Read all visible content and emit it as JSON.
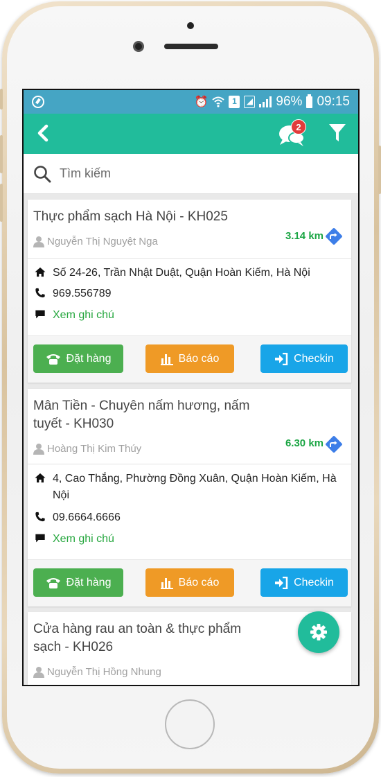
{
  "status_bar": {
    "battery_percent": "96%",
    "time": "09:15",
    "sim_slot": "1"
  },
  "app_bar": {
    "back_icon": "chevron-left-icon",
    "chat_icon": "chat-bubbles-icon",
    "chat_badge": "2",
    "filter_icon": "filter-icon"
  },
  "search": {
    "placeholder": "Tìm kiếm",
    "value": ""
  },
  "customers": [
    {
      "title": "Thực phẩm sạch Hà Nội - KH025",
      "owner": "Nguyễn Thị Nguyệt Nga",
      "distance": "3.14 km",
      "address": "Số 24-26, Trần Nhật Duật, Quận Hoàn Kiếm, Hà Nội",
      "phone": "969.556789",
      "note_link": "Xem ghi chú",
      "buttons": {
        "order": "Đặt hàng",
        "report": "Báo cáo",
        "checkin": "Checkin"
      }
    },
    {
      "title": "Mân Tiền - Chuyên nấm hương, nấm tuyết - KH030",
      "owner": "Hoàng Thị Kim Thúy",
      "distance": "6.30 km",
      "address": "4, Cao Thắng, Phường Đồng Xuân, Quận Hoàn Kiếm, Hà Nội",
      "phone": "09.6664.6666",
      "note_link": "Xem ghi chú",
      "buttons": {
        "order": "Đặt hàng",
        "report": "Báo cáo",
        "checkin": "Checkin"
      }
    },
    {
      "title": "Cửa hàng rau an toàn & thực phẩm sạch - KH026",
      "owner": "Nguyễn Thị Hồng Nhung"
    }
  ],
  "fab_icon": "gear-icon",
  "colors": {
    "status_bar": "#45a5c4",
    "app_bar": "#21bc9b",
    "order_button": "#4caf50",
    "report_button": "#ef9a26",
    "checkin_button": "#18a5e8",
    "distance_text": "#1aa543",
    "note_text": "#24a63d",
    "badge": "#e13b3b"
  }
}
